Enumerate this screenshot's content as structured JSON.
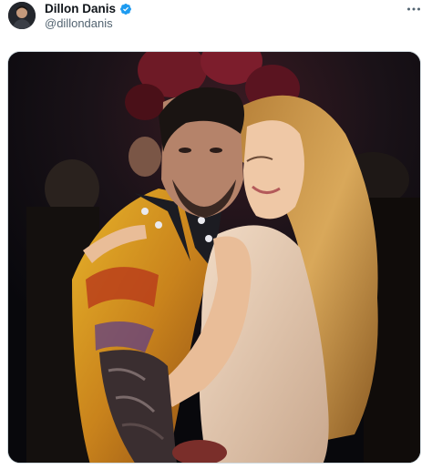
{
  "post": {
    "author": {
      "display_name": "Dillon Danis",
      "handle": "@dillondanis",
      "verified": true,
      "verified_icon": "verified-badge-icon",
      "verified_color": "#1d9bf0"
    },
    "more_icon": "more-horizontal-icon",
    "media": {
      "kind": "photo",
      "subjects": [
        "man-in-patterned-shirt",
        "woman-in-satin-dress"
      ]
    }
  },
  "colors": {
    "name": "#0f1419",
    "handle": "#536471",
    "border": "#cfd9de",
    "photo_background": "#0c0c12"
  }
}
